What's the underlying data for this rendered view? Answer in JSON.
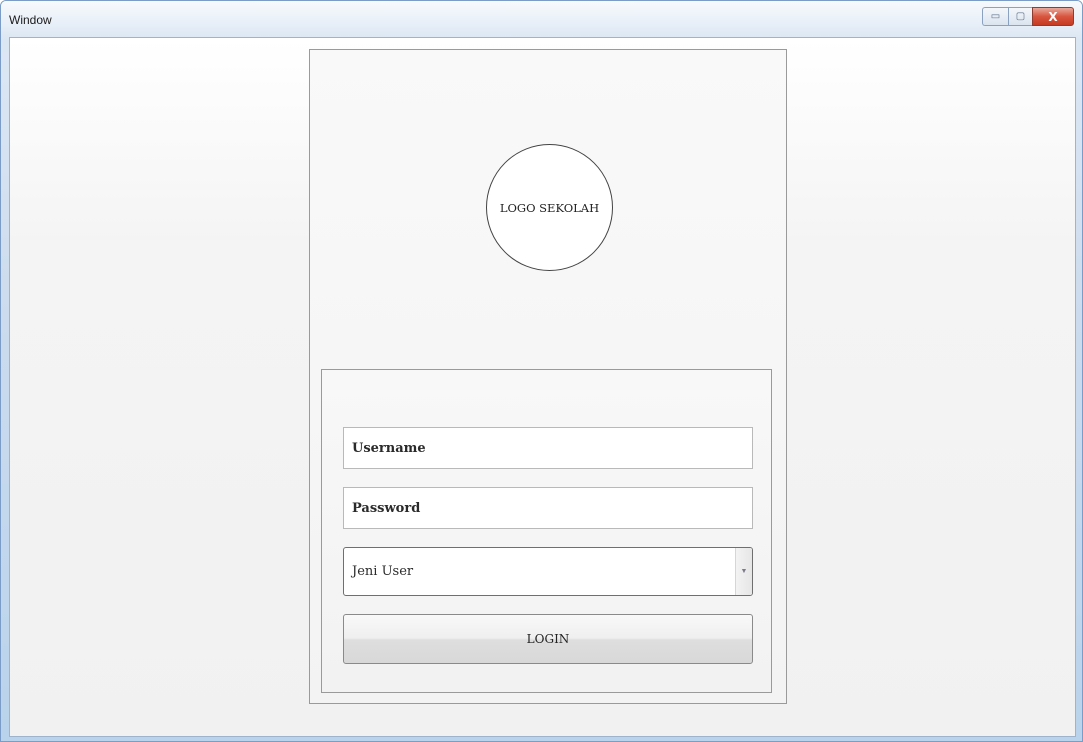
{
  "window": {
    "title": "Window",
    "minimize_glyph": "▭",
    "maximize_glyph": "▢",
    "close_glyph": "X"
  },
  "login": {
    "logo_text": "LOGO SEKOLAH",
    "username_placeholder": "Username",
    "password_placeholder": "Password",
    "user_type_selected": "Jeni User",
    "login_label": "LOGIN"
  },
  "icons": {
    "dropdown_arrow": "▼"
  }
}
